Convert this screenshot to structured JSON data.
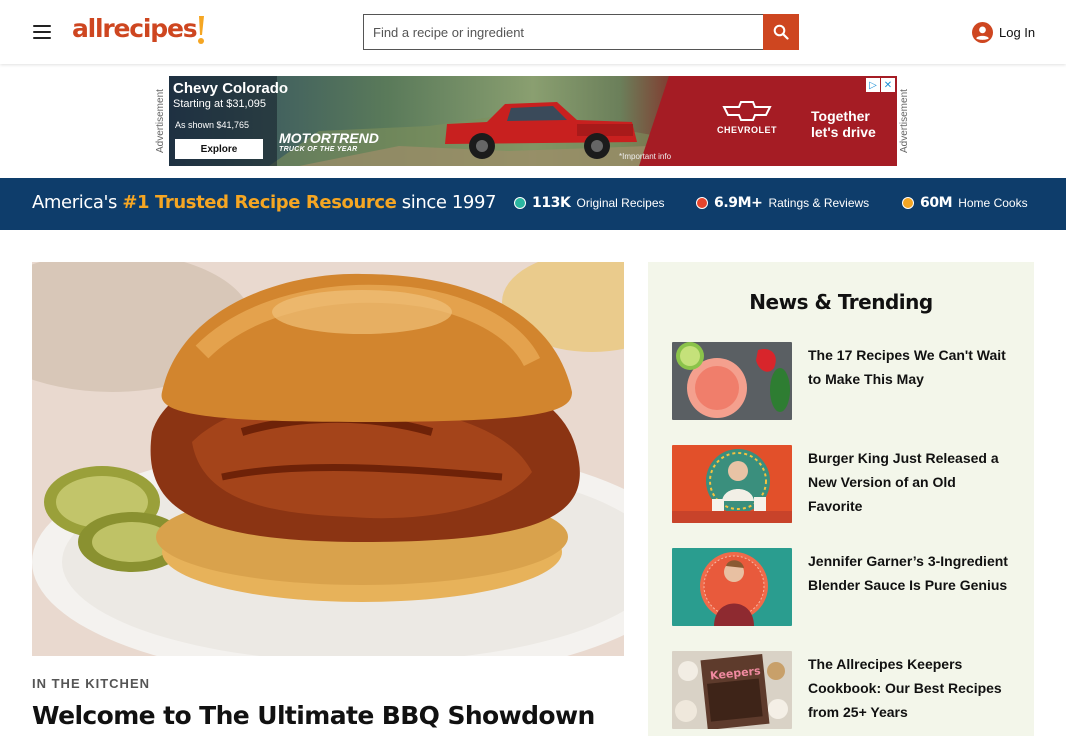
{
  "header": {
    "logo_text": "allrecipes",
    "search_placeholder": "Find a recipe or ingredient",
    "login_label": "Log In"
  },
  "ad": {
    "side_label": "Advertisement",
    "title": "Chevy Colorado",
    "subtitle": "Starting at $31,095",
    "shown": "As shown $41,765",
    "explore": "Explore",
    "motortrend": "MOTORTREND",
    "motortrend_sub": "TRUCK OF THE YEAR",
    "important": "*Important info",
    "brand": "CHEVROLET",
    "tagline_1": "Together",
    "tagline_2": "let's drive"
  },
  "trust_bar": {
    "prefix": "America's",
    "highlight": "#1 Trusted Recipe Resource",
    "suffix": "since 1997",
    "stats": [
      {
        "value": "113K",
        "label": "Original Recipes",
        "color": "#2bb5a0"
      },
      {
        "value": "6.9M+",
        "label": "Ratings & Reviews",
        "color": "#e8452c"
      },
      {
        "value": "60M",
        "label": "Home Cooks",
        "color": "#f5a623"
      }
    ]
  },
  "hero": {
    "kicker": "IN THE KITCHEN",
    "title": "Welcome to The Ultimate BBQ Showdown"
  },
  "news": {
    "title": "News & Trending",
    "items": [
      {
        "title": "The 17 Recipes We Can't Wait to Make This May"
      },
      {
        "title": "Burger King Just Released a New Version of an Old Favorite"
      },
      {
        "title": "Jennifer Garner’s 3-Ingredient Blender Sauce Is Pure Genius"
      },
      {
        "title": "The Allrecipes Keepers Cookbook: Our Best Recipes from 25+ Years"
      }
    ]
  },
  "colors": {
    "brand": "#ce4620",
    "trust_bar_bg": "#0e3d6b",
    "trust_highlight": "#f5a623",
    "news_bg": "#f3f6ea"
  }
}
